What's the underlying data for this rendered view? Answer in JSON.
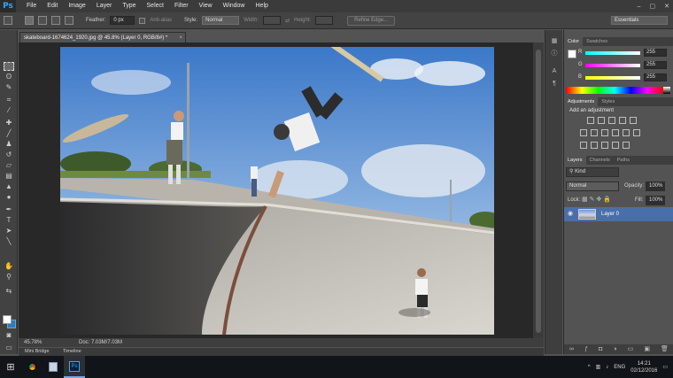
{
  "app": {
    "logo": "Ps"
  },
  "menu": [
    "File",
    "Edit",
    "Image",
    "Layer",
    "Type",
    "Select",
    "Filter",
    "View",
    "Window",
    "Help"
  ],
  "window_controls": [
    "–",
    "▢",
    "✕"
  ],
  "options": {
    "feather_label": "Feather:",
    "feather_value": "0 px",
    "antialias_label": "Anti-alias",
    "style_label": "Style:",
    "style_value": "Normal",
    "width_label": "Width:",
    "height_label": "Height:",
    "refine_edge": "Refine Edge...",
    "workspace": "Essentials"
  },
  "document": {
    "tab_title": "skateboard-1674624_1920.jpg @ 45.8% (Layer 0, RGB/8#) *",
    "zoom": "45.78%",
    "doc_size": "Doc: 7.03M/7.03M"
  },
  "bottom_tabs": [
    "Mini Bridge",
    "Timeline"
  ],
  "color_panel": {
    "tabs": [
      "Color",
      "Swatches"
    ],
    "r_label": "R",
    "r_value": "255",
    "g_label": "G",
    "g_value": "255",
    "b_label": "B",
    "b_value": "255"
  },
  "adjustments_panel": {
    "tabs": [
      "Adjustments",
      "Styles"
    ],
    "title": "Add an adjustment"
  },
  "layers_panel": {
    "tabs": [
      "Layers",
      "Channels",
      "Paths"
    ],
    "kind": "Kind",
    "blend_mode": "Normal",
    "opacity_label": "Opacity:",
    "opacity_value": "100%",
    "lock_label": "Lock:",
    "fill_label": "Fill:",
    "fill_value": "100%",
    "layer_name": "Layer 0"
  },
  "taskbar": {
    "lang": "ENG",
    "time": "14:21",
    "date": "02/12/2016"
  },
  "colors": {
    "accent": "#31a8ff",
    "selection": "#4a6fa8",
    "background_color": "#1f7fd0"
  }
}
